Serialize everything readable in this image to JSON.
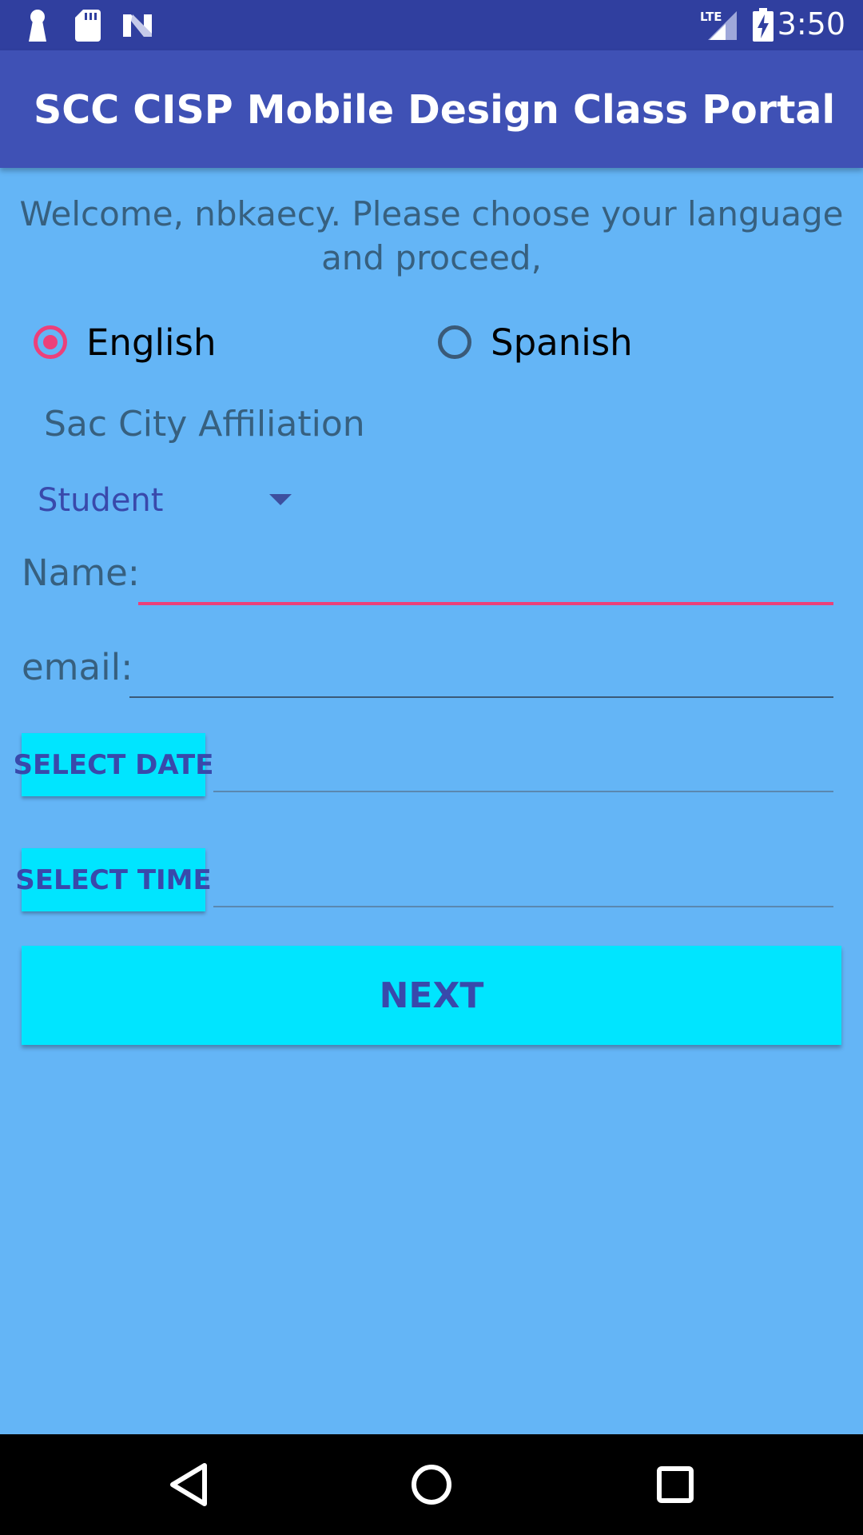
{
  "status_bar": {
    "time": "3:50",
    "network": "LTE",
    "icons": [
      "keyhole-icon",
      "sd-card-icon",
      "n-logo-icon",
      "lte-signal-icon",
      "battery-charging-icon"
    ]
  },
  "app_bar": {
    "title": "SCC CISP Mobile Design Class Portal"
  },
  "welcome": {
    "line1": "Welcome, nbkaecy. Please choose your language",
    "line2": "and proceed,"
  },
  "language": {
    "options": [
      {
        "label": "English",
        "checked": true
      },
      {
        "label": "Spanish",
        "checked": false
      }
    ]
  },
  "affiliation": {
    "label": "Sac City Affiliation",
    "selected": "Student"
  },
  "form": {
    "name_label": "Name:",
    "name_value": "",
    "email_label": "email:",
    "email_value": "",
    "select_date_label": "SELECT DATE",
    "date_value": "",
    "select_time_label": "SELECT TIME",
    "time_value": "",
    "next_label": "NEXT"
  },
  "colors": {
    "status_bar": "#303f9f",
    "app_bar": "#3f51b5",
    "background": "#64b5f6",
    "accent": "#ec407a",
    "button": "#00e5ff",
    "button_text": "#3949ab"
  },
  "nav_bar": {
    "icons": [
      "back-icon",
      "home-icon",
      "recents-icon"
    ]
  }
}
